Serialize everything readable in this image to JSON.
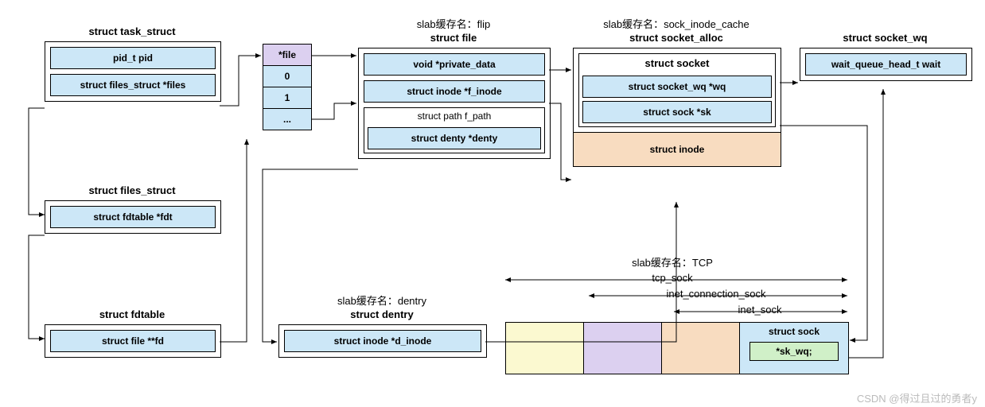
{
  "task_struct": {
    "title": "struct task_struct",
    "fields": [
      "pid_t pid",
      "struct files_struct *files"
    ]
  },
  "files_struct": {
    "title": "struct files_struct",
    "fields": [
      "struct fdtable *fdt"
    ]
  },
  "fdtable": {
    "title": "struct fdtable",
    "fields": [
      "struct file **fd"
    ]
  },
  "fdarray": {
    "cells": [
      "*file",
      "0",
      "1",
      "..."
    ]
  },
  "struct_file": {
    "caption": "slab缓存名：flip",
    "title": "struct file",
    "fields": [
      "void *private_data",
      "struct inode *f_inode"
    ],
    "path_title": "struct path f_path",
    "path_field": "struct denty *denty"
  },
  "socket_alloc": {
    "caption": "slab缓存名：sock_inode_cache",
    "title": "struct socket_alloc",
    "socket_title": "struct socket",
    "socket_fields": [
      "struct socket_wq *wq",
      "struct sock *sk"
    ],
    "inode_label": "struct inode"
  },
  "socket_wq": {
    "title": "struct socket_wq",
    "field": "wait_queue_head_t wait"
  },
  "dentry": {
    "caption": "slab缓存名：dentry",
    "title": "struct dentry",
    "field": "struct inode *d_inode"
  },
  "tcp_block": {
    "caption": "slab缓存名：TCP",
    "ranges": [
      "tcp_sock",
      "inet_connection_sock",
      "inet_sock"
    ],
    "sock_title": "struct sock",
    "sock_field": "*sk_wq;"
  },
  "watermark": "CSDN @得过且过的勇者y"
}
